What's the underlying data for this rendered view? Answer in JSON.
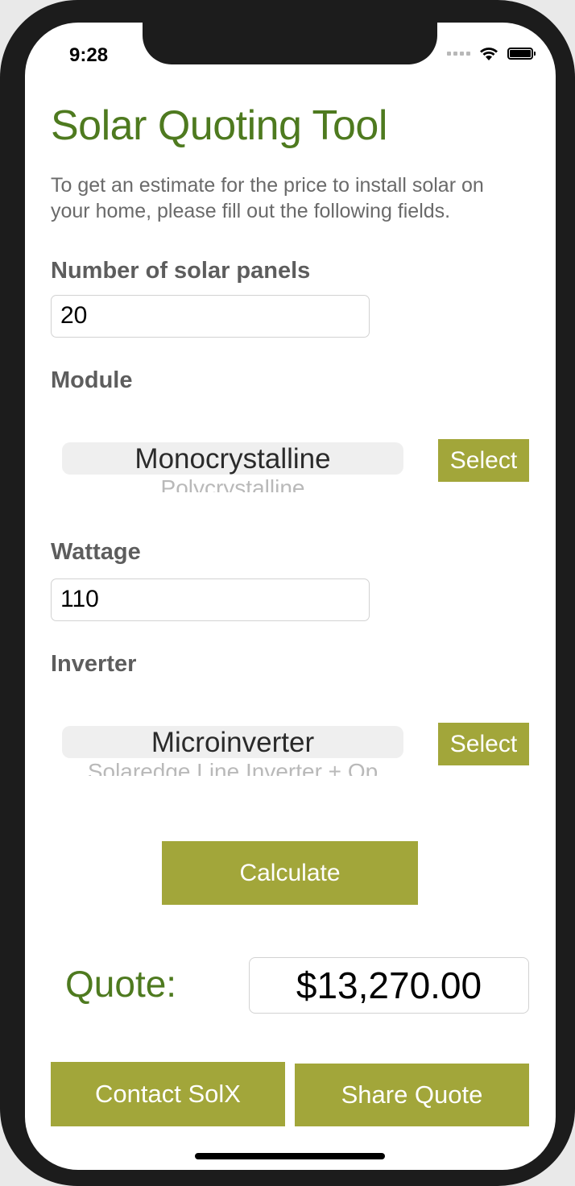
{
  "status_bar": {
    "time": "9:28"
  },
  "app": {
    "title": "Solar Quoting Tool",
    "intro": "To get an estimate for the price to install solar on your home, please fill out the following fields."
  },
  "panels": {
    "label": "Number of solar panels",
    "value": "20"
  },
  "module": {
    "label": "Module",
    "selected": "Monocrystalline",
    "next_option": "Polycrystalline",
    "select_label": "Select"
  },
  "wattage": {
    "label": "Wattage",
    "value": "110"
  },
  "inverter": {
    "label": "Inverter",
    "selected": "Microinverter",
    "next_option": "Solaredge Line Inverter + Op",
    "select_label": "Select"
  },
  "calculate_label": "Calculate",
  "quote": {
    "label": "Quote:",
    "value": "$13,270.00"
  },
  "actions": {
    "contact_label": "Contact SolX",
    "share_label": "Share Quote"
  },
  "colors": {
    "accent_green": "#4e7a1f",
    "button_olive": "#a2a63a"
  },
  "icons": [
    "wifi-icon",
    "battery-icon",
    "cellular-signal-icon"
  ]
}
